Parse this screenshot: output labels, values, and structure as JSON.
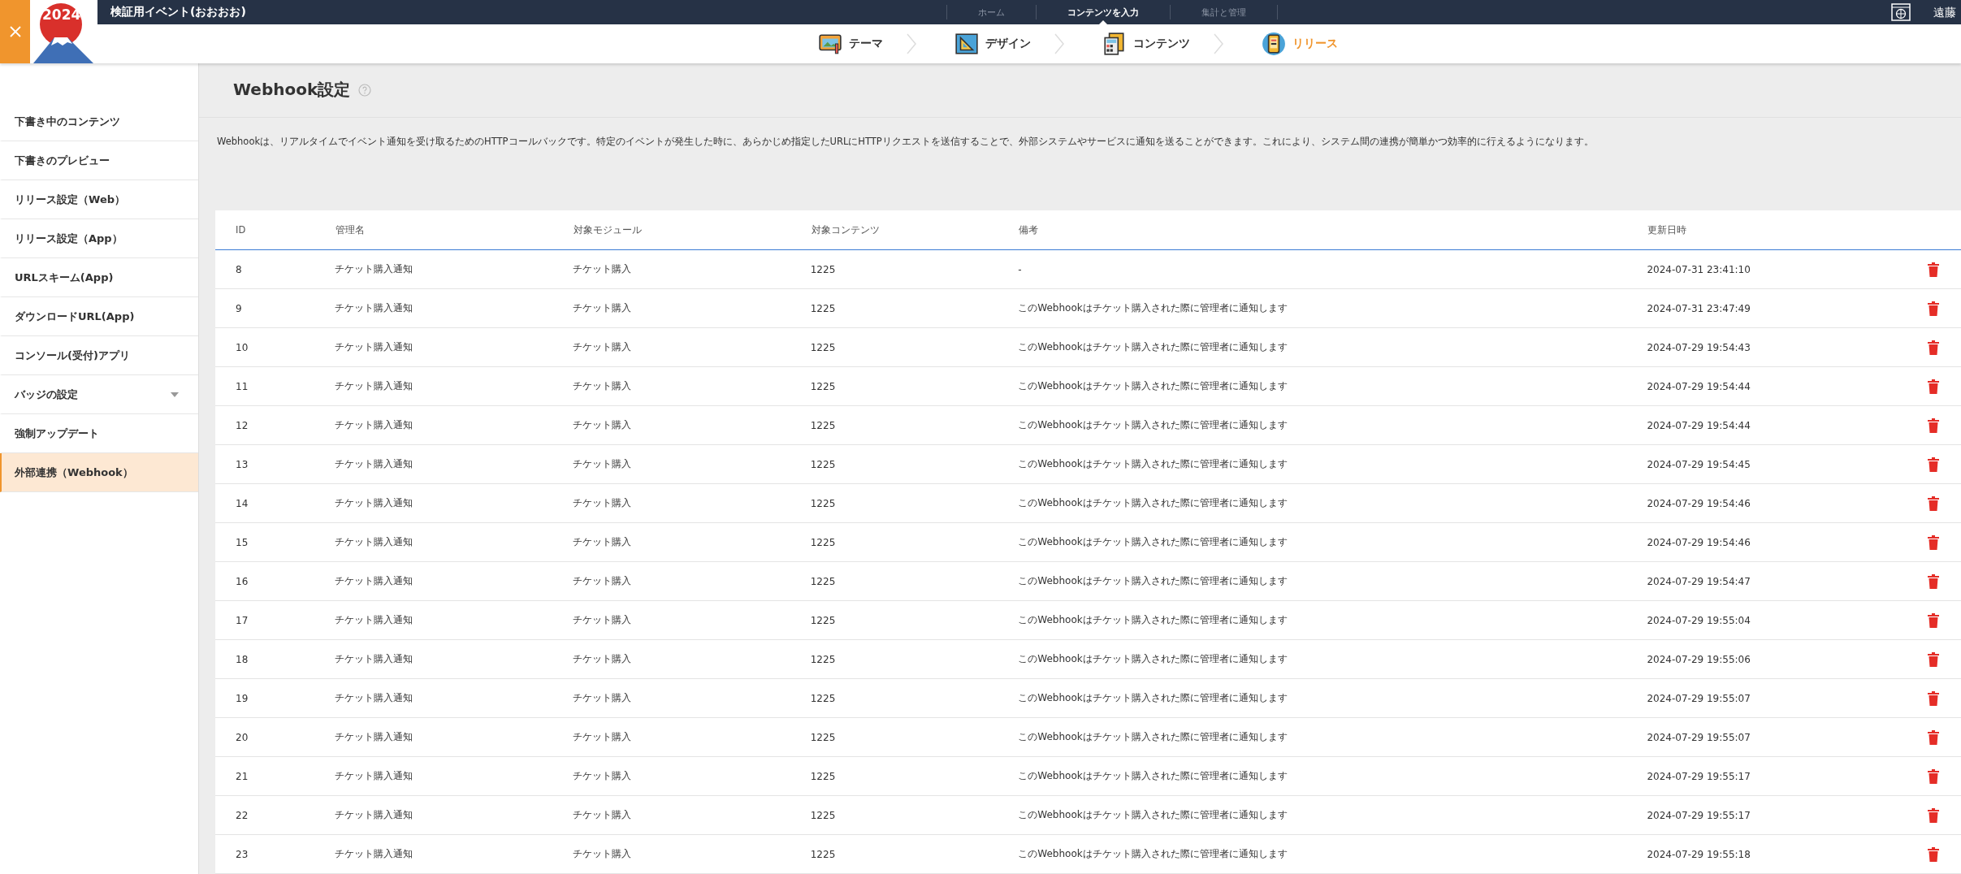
{
  "header": {
    "logo_text": "2024",
    "event_title": "検証用イベント(おおおお)",
    "nav": [
      {
        "label": "ホーム",
        "selected": false
      },
      {
        "label": "コンテンツを入力",
        "selected": true
      },
      {
        "label": "集計と管理",
        "selected": false
      }
    ],
    "user": "遠藤"
  },
  "steps": [
    {
      "label": "テーマ",
      "kind": "theme",
      "selected": false
    },
    {
      "label": "デザイン",
      "kind": "design",
      "selected": false
    },
    {
      "label": "コンテンツ",
      "kind": "content",
      "selected": false
    },
    {
      "label": "リリース",
      "kind": "release",
      "selected": true
    }
  ],
  "sidebar": {
    "items": [
      {
        "label": "下書き中のコンテンツ",
        "kind": "link",
        "selected": false
      },
      {
        "label": "下書きのプレビュー",
        "kind": "link",
        "selected": false
      },
      {
        "label": "リリース設定（Web）",
        "kind": "link",
        "selected": false
      },
      {
        "label": "リリース設定（App）",
        "kind": "link",
        "selected": false
      },
      {
        "label": "URLスキーム(App)",
        "kind": "link",
        "selected": false
      },
      {
        "label": "ダウンロードURL(App)",
        "kind": "link",
        "selected": false
      },
      {
        "label": "コンソール(受付)アプリ",
        "kind": "link",
        "selected": false
      },
      {
        "label": "バッジの設定",
        "kind": "dropdown",
        "selected": false
      },
      {
        "label": "強制アップデート",
        "kind": "link",
        "selected": false
      },
      {
        "label": "外部連携（Webhook）",
        "kind": "link",
        "selected": true
      }
    ]
  },
  "page": {
    "title": "Webhook設定",
    "description": "Webhookは、リアルタイムでイベント通知を受け取るためのHTTPコールバックです。特定のイベントが発生した時に、あらかじめ指定したURLにHTTPリクエストを送信することで、外部システムやサービスに通知を送ることができます。これにより、システム間の連携が簡単かつ効率的に行えるようになります。"
  },
  "table": {
    "columns": [
      "ID",
      "管理名",
      "対象モジュール",
      "対象コンテンツ",
      "備考",
      "更新日時"
    ],
    "rows": [
      [
        "8",
        "チケット購入通知",
        "チケット購入",
        "1225",
        "-",
        "2024-07-31 23:41:10"
      ],
      [
        "9",
        "チケット購入通知",
        "チケット購入",
        "1225",
        "このWebhookはチケット購入された際に管理者に通知します",
        "2024-07-31 23:47:49"
      ],
      [
        "10",
        "チケット購入通知",
        "チケット購入",
        "1225",
        "このWebhookはチケット購入された際に管理者に通知します",
        "2024-07-29 19:54:43"
      ],
      [
        "11",
        "チケット購入通知",
        "チケット購入",
        "1225",
        "このWebhookはチケット購入された際に管理者に通知します",
        "2024-07-29 19:54:44"
      ],
      [
        "12",
        "チケット購入通知",
        "チケット購入",
        "1225",
        "このWebhookはチケット購入された際に管理者に通知します",
        "2024-07-29 19:54:44"
      ],
      [
        "13",
        "チケット購入通知",
        "チケット購入",
        "1225",
        "このWebhookはチケット購入された際に管理者に通知します",
        "2024-07-29 19:54:45"
      ],
      [
        "14",
        "チケット購入通知",
        "チケット購入",
        "1225",
        "このWebhookはチケット購入された際に管理者に通知します",
        "2024-07-29 19:54:46"
      ],
      [
        "15",
        "チケット購入通知",
        "チケット購入",
        "1225",
        "このWebhookはチケット購入された際に管理者に通知します",
        "2024-07-29 19:54:46"
      ],
      [
        "16",
        "チケット購入通知",
        "チケット購入",
        "1225",
        "このWebhookはチケット購入された際に管理者に通知します",
        "2024-07-29 19:54:47"
      ],
      [
        "17",
        "チケット購入通知",
        "チケット購入",
        "1225",
        "このWebhookはチケット購入された際に管理者に通知します",
        "2024-07-29 19:55:04"
      ],
      [
        "18",
        "チケット購入通知",
        "チケット購入",
        "1225",
        "このWebhookはチケット購入された際に管理者に通知します",
        "2024-07-29 19:55:06"
      ],
      [
        "19",
        "チケット購入通知",
        "チケット購入",
        "1225",
        "このWebhookはチケット購入された際に管理者に通知します",
        "2024-07-29 19:55:07"
      ],
      [
        "20",
        "チケット購入通知",
        "チケット購入",
        "1225",
        "このWebhookはチケット購入された際に管理者に通知します",
        "2024-07-29 19:55:07"
      ],
      [
        "21",
        "チケット購入通知",
        "チケット購入",
        "1225",
        "このWebhookはチケット購入された際に管理者に通知します",
        "2024-07-29 19:55:17"
      ],
      [
        "22",
        "チケット購入通知",
        "チケット購入",
        "1225",
        "このWebhookはチケット購入された際に管理者に通知します",
        "2024-07-29 19:55:17"
      ],
      [
        "23",
        "チケット購入通知",
        "チケット購入",
        "1225",
        "このWebhookはチケット購入された際に管理者に通知します",
        "2024-07-29 19:55:18"
      ]
    ]
  }
}
